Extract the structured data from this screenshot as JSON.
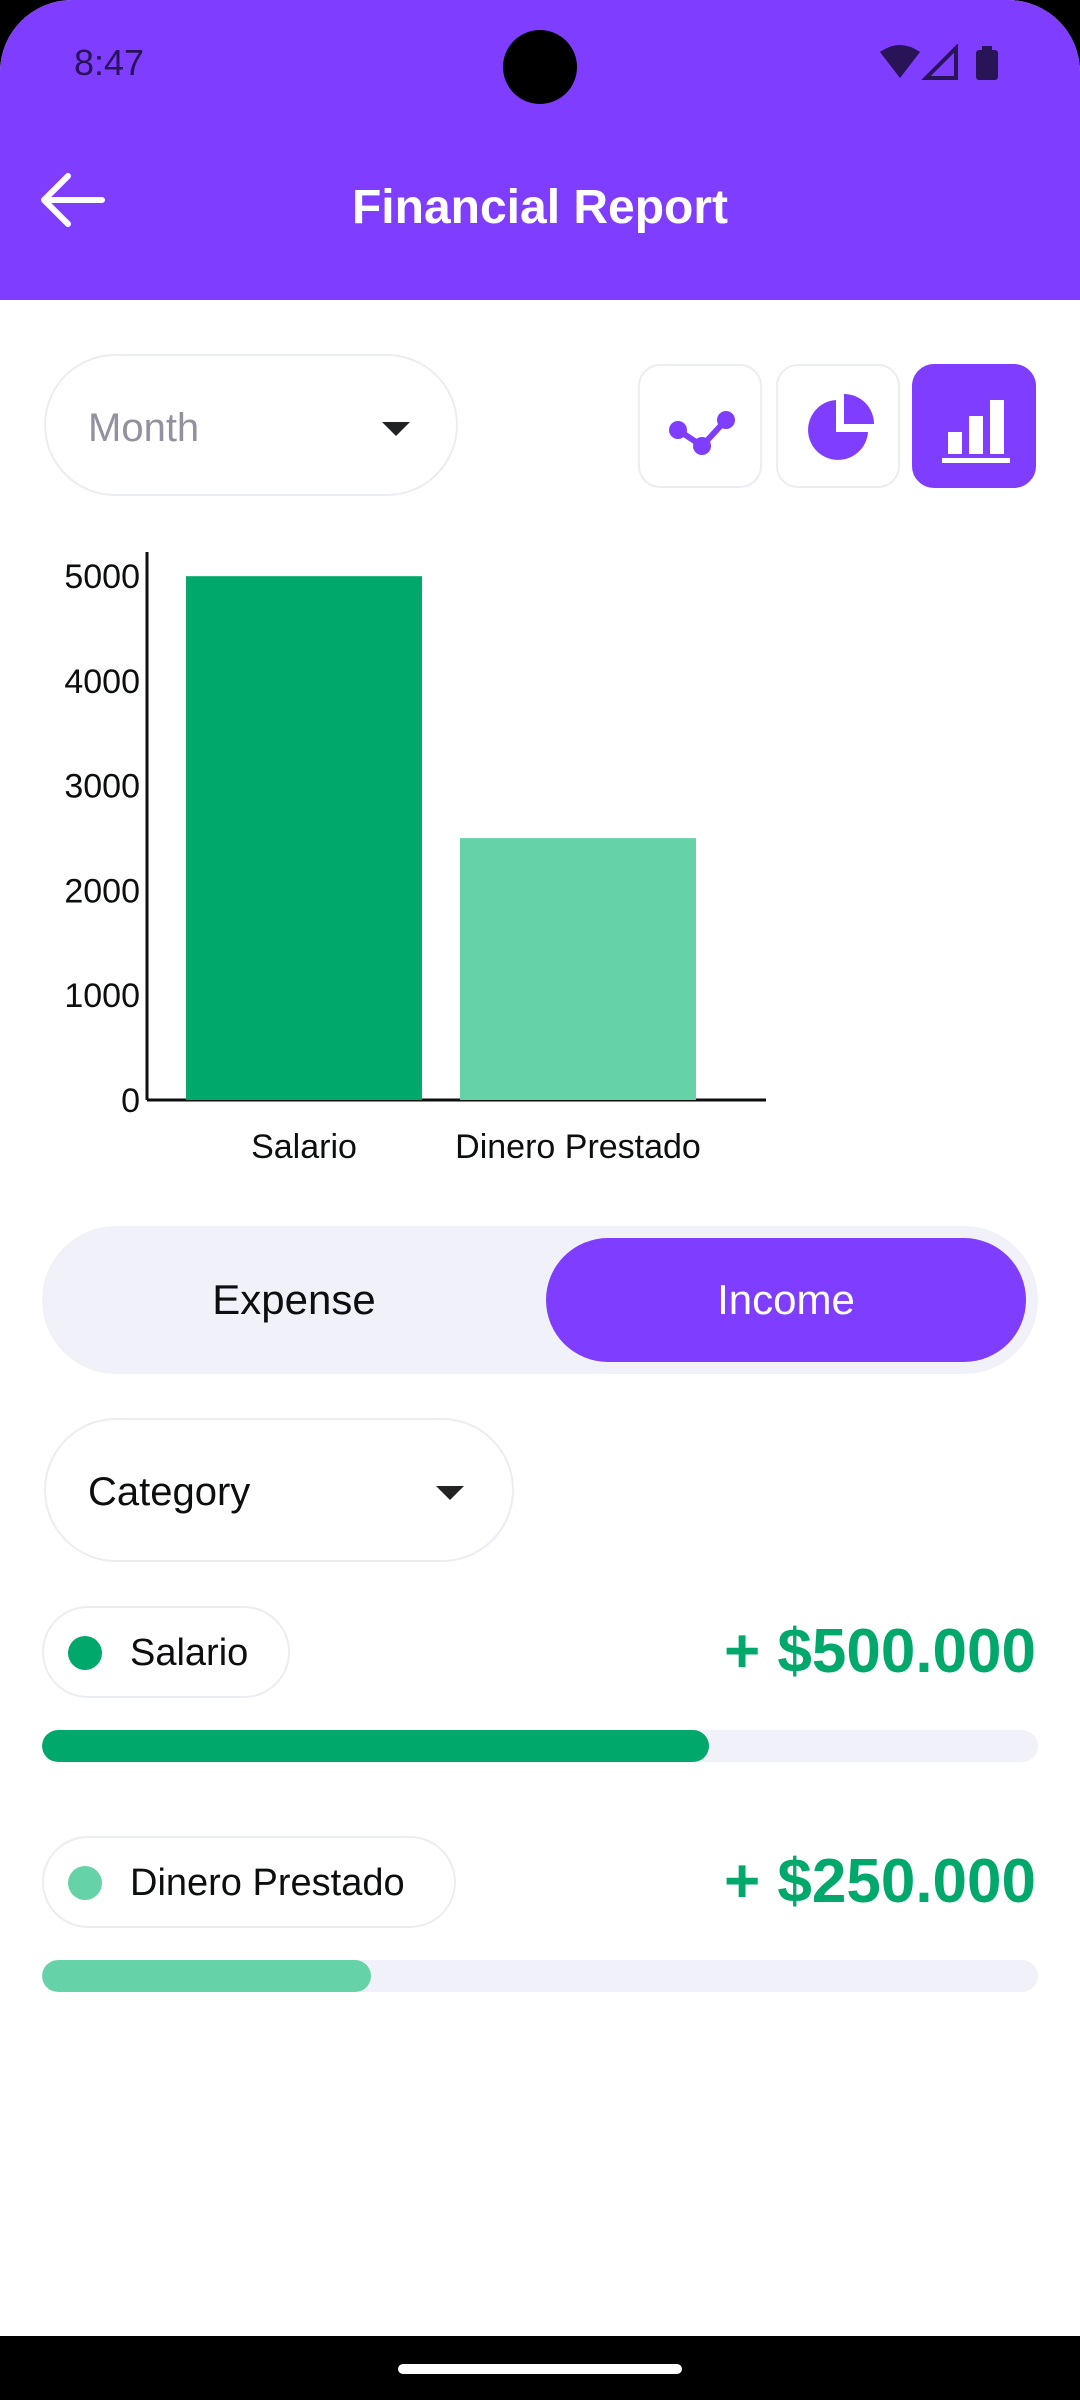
{
  "status_bar": {
    "time": "8:47"
  },
  "header": {
    "title": "Financial Report"
  },
  "filters": {
    "period": "Month",
    "category": "Category"
  },
  "chart_type_buttons": [
    {
      "icon": "line-chart-icon",
      "active": false
    },
    {
      "icon": "pie-chart-icon",
      "active": false
    },
    {
      "icon": "bar-chart-icon",
      "active": true
    }
  ],
  "tabs": {
    "expense": "Expense",
    "income": "Income",
    "selected": "Income"
  },
  "chart_data": {
    "type": "bar",
    "categories": [
      "Salario",
      "Dinero Prestado"
    ],
    "values": [
      5000,
      2500
    ],
    "colors": [
      "#00A86B",
      "#66D2A8"
    ],
    "yticks": [
      "0",
      "1000",
      "2000",
      "3000",
      "4000",
      "5000"
    ],
    "ylim": [
      0,
      5250
    ],
    "grid": false
  },
  "categories": [
    {
      "label": "Salario",
      "amount": "+ $500.000",
      "color": "#00A86B",
      "progress": 0.67
    },
    {
      "label": "Dinero Prestado",
      "amount": "+ $250.000",
      "color": "#66D2A8",
      "progress": 0.33
    }
  ],
  "colors": {
    "accent": "#7F3DFF",
    "income": "#00A86B"
  }
}
